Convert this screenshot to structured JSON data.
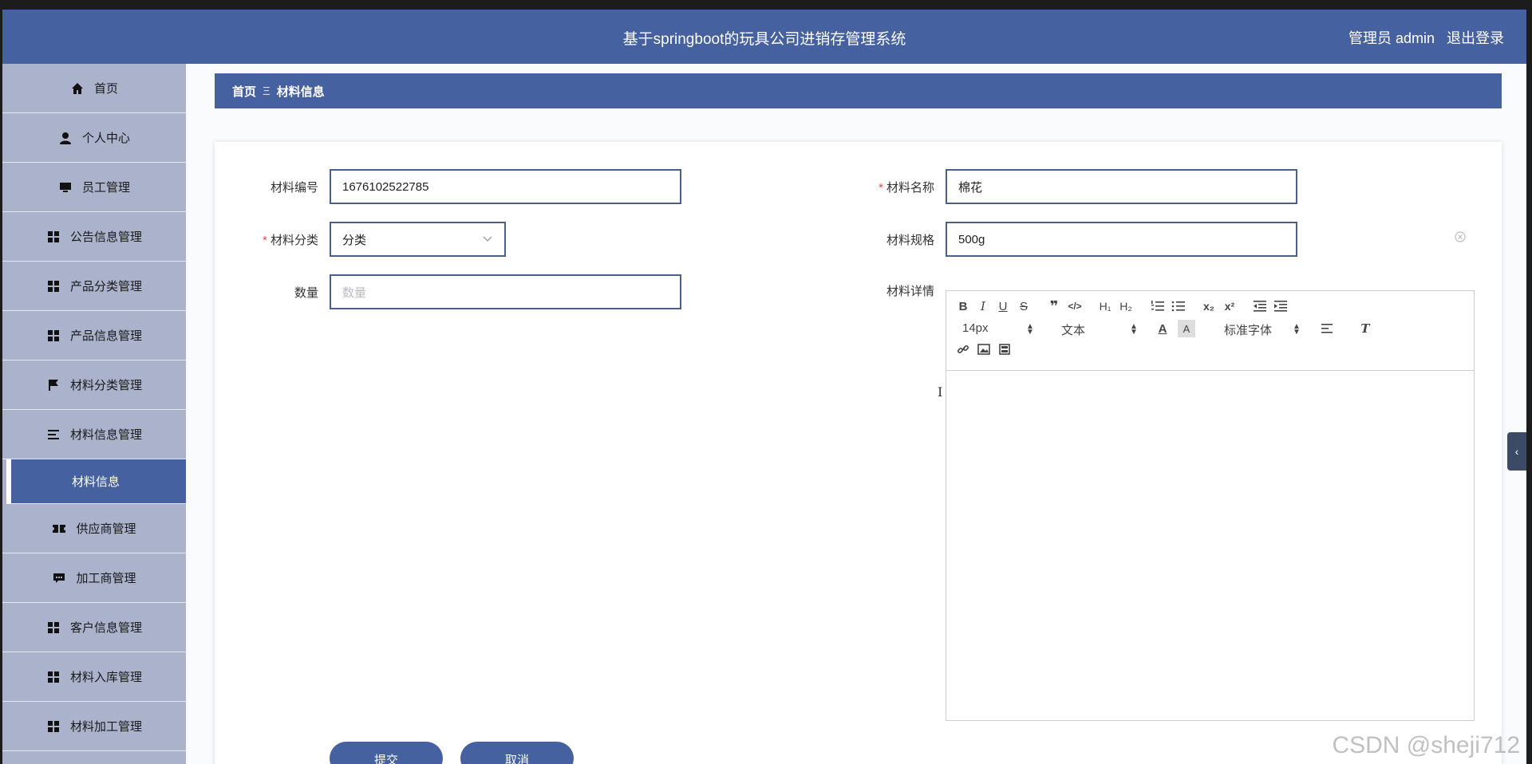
{
  "header": {
    "title": "基于springboot的玩具公司进销存管理系统",
    "role": "管理员 admin",
    "logout": "退出登录"
  },
  "sidebar": {
    "items": [
      {
        "label": "首页",
        "icon": "home-icon"
      },
      {
        "label": "个人中心",
        "icon": "user-icon"
      },
      {
        "label": "员工管理",
        "icon": "monitor-icon"
      },
      {
        "label": "公告信息管理",
        "icon": "grid-icon"
      },
      {
        "label": "产品分类管理",
        "icon": "grid-icon"
      },
      {
        "label": "产品信息管理",
        "icon": "grid-icon"
      },
      {
        "label": "材料分类管理",
        "icon": "flag-icon"
      },
      {
        "label": "材料信息管理",
        "icon": "list-icon"
      },
      {
        "label": "材料信息",
        "icon": ""
      },
      {
        "label": "供应商管理",
        "icon": "ticket-icon"
      },
      {
        "label": "加工商管理",
        "icon": "chat-icon"
      },
      {
        "label": "客户信息管理",
        "icon": "grid-icon"
      },
      {
        "label": "材料入库管理",
        "icon": "grid-icon"
      },
      {
        "label": "材料加工管理",
        "icon": "grid-icon"
      }
    ]
  },
  "breadcrumb": {
    "home": "首页",
    "separator": "Ξ",
    "current": "材料信息"
  },
  "form": {
    "code_label": "材料编号",
    "code_value": "1676102522785",
    "name_label": "材料名称",
    "name_value": "棉花",
    "category_label": "材料分类",
    "category_value": "分类",
    "spec_label": "材料规格",
    "spec_value": "500g",
    "quantity_label": "数量",
    "quantity_placeholder": "数量",
    "detail_label": "材料详情",
    "required_mark": "*"
  },
  "editor": {
    "font_size": "14px",
    "text_type": "文本",
    "font_family": "标准字体"
  },
  "buttons": {
    "submit": "提交",
    "cancel": "取消"
  },
  "watermark": "CSDN @sheji712",
  "colors": {
    "primary": "#4561a0",
    "sidebar_bg": "#aab2cc",
    "required": "#e24c4c"
  }
}
